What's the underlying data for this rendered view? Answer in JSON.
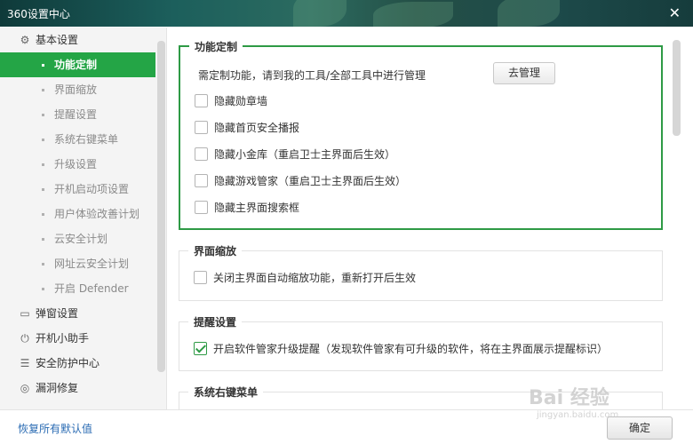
{
  "window": {
    "title": "360设置中心"
  },
  "sidebar": {
    "items": [
      {
        "type": "group",
        "label": "基本设置",
        "icon": "gear-icon"
      },
      {
        "type": "sub",
        "label": "功能定制",
        "active": true
      },
      {
        "type": "sub",
        "label": "界面缩放"
      },
      {
        "type": "sub",
        "label": "提醒设置"
      },
      {
        "type": "sub",
        "label": "系统右键菜单"
      },
      {
        "type": "sub",
        "label": "升级设置"
      },
      {
        "type": "sub",
        "label": "开机启动项设置"
      },
      {
        "type": "sub",
        "label": "用户体验改善计划"
      },
      {
        "type": "sub",
        "label": "云安全计划"
      },
      {
        "type": "sub",
        "label": "网址云安全计划"
      },
      {
        "type": "sub",
        "label": "开启 Defender"
      },
      {
        "type": "group",
        "label": "弹窗设置",
        "icon": "window-icon"
      },
      {
        "type": "group",
        "label": "开机小助手",
        "icon": "power-icon"
      },
      {
        "type": "group",
        "label": "安全防护中心",
        "icon": "sliders-icon"
      },
      {
        "type": "group",
        "label": "漏洞修复",
        "icon": "target-icon"
      }
    ]
  },
  "sections": {
    "feature": {
      "title": "功能定制",
      "hint": "需定制功能，请到我的工具/全部工具中进行管理",
      "manage_button": "去管理",
      "options": [
        {
          "label": "隐藏勋章墙",
          "checked": false
        },
        {
          "label": "隐藏首页安全播报",
          "checked": false
        },
        {
          "label": "隐藏小金库（重启卫士主界面后生效）",
          "checked": false
        },
        {
          "label": "隐藏游戏管家（重启卫士主界面后生效）",
          "checked": false
        },
        {
          "label": "隐藏主界面搜索框",
          "checked": false
        }
      ]
    },
    "zoom": {
      "title": "界面缩放",
      "option": {
        "label": "关闭主界面自动缩放功能，重新打开后生效",
        "checked": false
      }
    },
    "reminder": {
      "title": "提醒设置",
      "option": {
        "label": "开启软件管家升级提醒（发现软件管家有可升级的软件，将在主界面展示提醒标识）",
        "checked": true
      }
    },
    "context_menu": {
      "title": "系统右键菜单"
    }
  },
  "footer": {
    "restore_label": "恢复所有默认值",
    "ok_label": "确定"
  },
  "watermark": {
    "text": "Bai 经验",
    "sub": "jingyan.baidu.com"
  },
  "colors": {
    "accent": "#24a546",
    "link": "#2a6bb3"
  }
}
